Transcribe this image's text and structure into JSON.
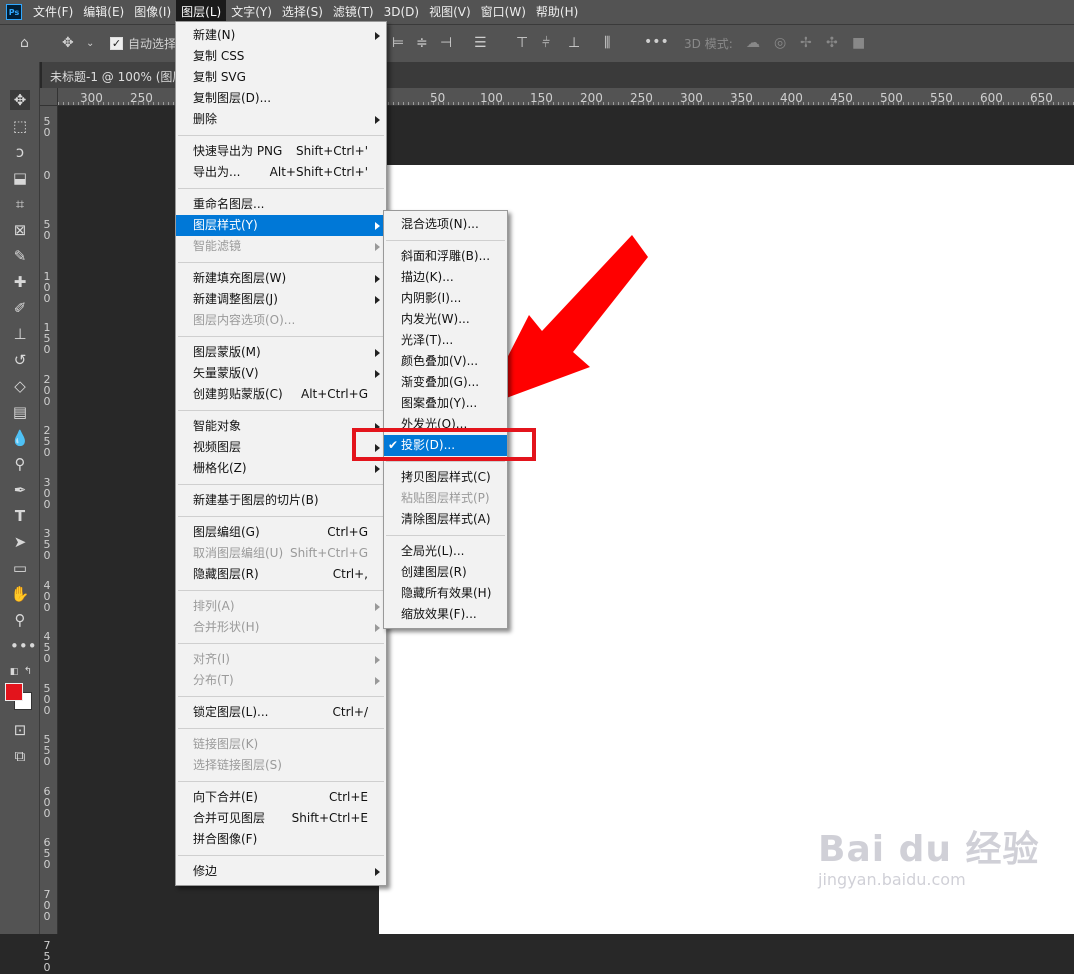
{
  "menubar": {
    "logo": "Ps",
    "items": [
      "文件(F)",
      "编辑(E)",
      "图像(I)",
      "图层(L)",
      "文字(Y)",
      "选择(S)",
      "滤镜(T)",
      "3D(D)",
      "视图(V)",
      "窗口(W)",
      "帮助(H)"
    ],
    "active_index": 3
  },
  "options_bar": {
    "auto_select_label": "自动选择",
    "mode_3d_label": "3D 模式:"
  },
  "document": {
    "tab_title": "未标题-1 @ 100% (图层"
  },
  "rulers": {
    "horizontal": [
      "300",
      "250",
      "50",
      "100",
      "150",
      "200",
      "250",
      "300",
      "350",
      "400",
      "450",
      "500",
      "550",
      "600",
      "650"
    ],
    "vertical": [
      [
        "5",
        "0"
      ],
      [
        "0"
      ],
      [
        "5",
        "0"
      ],
      [
        "1",
        "0",
        "0"
      ],
      [
        "1",
        "5",
        "0"
      ],
      [
        "2",
        "0",
        "0"
      ],
      [
        "2",
        "5",
        "0"
      ],
      [
        "3",
        "0",
        "0"
      ],
      [
        "3",
        "5",
        "0"
      ],
      [
        "4",
        "0",
        "0"
      ],
      [
        "4",
        "5",
        "0"
      ],
      [
        "5",
        "0",
        "0"
      ],
      [
        "5",
        "5",
        "0"
      ],
      [
        "6",
        "0",
        "0"
      ],
      [
        "6",
        "5",
        "0"
      ],
      [
        "7",
        "0",
        "0"
      ],
      [
        "7",
        "5",
        "0"
      ]
    ]
  },
  "layer_menu": {
    "items": [
      {
        "label": "新建(N)",
        "arrow": true
      },
      {
        "label": "复制 CSS"
      },
      {
        "label": "复制 SVG"
      },
      {
        "label": "复制图层(D)..."
      },
      {
        "label": "删除",
        "arrow": true
      },
      {
        "sep": true
      },
      {
        "label": "快速导出为 PNG",
        "shortcut": "Shift+Ctrl+'"
      },
      {
        "label": "导出为...",
        "shortcut": "Alt+Shift+Ctrl+'"
      },
      {
        "sep": true
      },
      {
        "label": "重命名图层..."
      },
      {
        "label": "图层样式(Y)",
        "arrow": true,
        "highlight": true
      },
      {
        "label": "智能滤镜",
        "arrow": true,
        "disabled": true
      },
      {
        "sep": true
      },
      {
        "label": "新建填充图层(W)",
        "arrow": true
      },
      {
        "label": "新建调整图层(J)",
        "arrow": true
      },
      {
        "label": "图层内容选项(O)...",
        "disabled": true
      },
      {
        "sep": true
      },
      {
        "label": "图层蒙版(M)",
        "arrow": true
      },
      {
        "label": "矢量蒙版(V)",
        "arrow": true
      },
      {
        "label": "创建剪贴蒙版(C)",
        "shortcut": "Alt+Ctrl+G"
      },
      {
        "sep": true
      },
      {
        "label": "智能对象",
        "arrow": true
      },
      {
        "label": "视频图层",
        "arrow": true
      },
      {
        "label": "栅格化(Z)",
        "arrow": true
      },
      {
        "sep": true
      },
      {
        "label": "新建基于图层的切片(B)"
      },
      {
        "sep": true
      },
      {
        "label": "图层编组(G)",
        "shortcut": "Ctrl+G"
      },
      {
        "label": "取消图层编组(U)",
        "shortcut": "Shift+Ctrl+G",
        "disabled": true
      },
      {
        "label": "隐藏图层(R)",
        "shortcut": "Ctrl+,"
      },
      {
        "sep": true
      },
      {
        "label": "排列(A)",
        "arrow": true,
        "disabled": true
      },
      {
        "label": "合并形状(H)",
        "arrow": true,
        "disabled": true
      },
      {
        "sep": true
      },
      {
        "label": "对齐(I)",
        "arrow": true,
        "disabled": true
      },
      {
        "label": "分布(T)",
        "arrow": true,
        "disabled": true
      },
      {
        "sep": true
      },
      {
        "label": "锁定图层(L)...",
        "shortcut": "Ctrl+/"
      },
      {
        "sep": true
      },
      {
        "label": "链接图层(K)",
        "disabled": true
      },
      {
        "label": "选择链接图层(S)",
        "disabled": true
      },
      {
        "sep": true
      },
      {
        "label": "向下合并(E)",
        "shortcut": "Ctrl+E"
      },
      {
        "label": "合并可见图层",
        "shortcut": "Shift+Ctrl+E"
      },
      {
        "label": "拼合图像(F)"
      },
      {
        "sep": true
      },
      {
        "label": "修边",
        "arrow": true
      }
    ]
  },
  "style_submenu": {
    "items": [
      {
        "label": "混合选项(N)..."
      },
      {
        "sep": true
      },
      {
        "label": "斜面和浮雕(B)..."
      },
      {
        "label": "描边(K)..."
      },
      {
        "label": "内阴影(I)..."
      },
      {
        "label": "内发光(W)..."
      },
      {
        "label": "光泽(T)..."
      },
      {
        "label": "颜色叠加(V)..."
      },
      {
        "label": "渐变叠加(G)..."
      },
      {
        "label": "图案叠加(Y)..."
      },
      {
        "label": "外发光(O)..."
      },
      {
        "label": "投影(D)...",
        "highlight": true,
        "checked": true
      },
      {
        "sep": true
      },
      {
        "label": "拷贝图层样式(C)"
      },
      {
        "label": "粘贴图层样式(P)",
        "disabled": true
      },
      {
        "label": "清除图层样式(A)"
      },
      {
        "sep": true
      },
      {
        "label": "全局光(L)..."
      },
      {
        "label": "创建图层(R)"
      },
      {
        "label": "隐藏所有效果(H)"
      },
      {
        "label": "缩放效果(F)..."
      }
    ]
  },
  "watermark": {
    "brand": "Bai du 经验",
    "url": "jingyan.baidu.com"
  },
  "colors": {
    "highlight": "#0078d7",
    "annotation_red": "#e3141c",
    "foreground_swatch": "#e3141c",
    "background_swatch": "#ffffff"
  }
}
